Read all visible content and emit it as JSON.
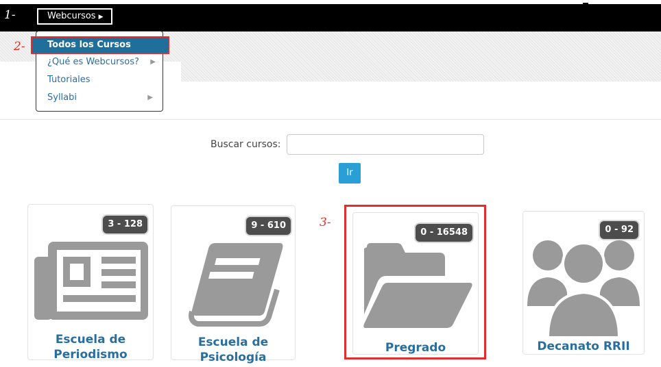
{
  "annotations": {
    "one": "1-",
    "two": "2-",
    "three": "3-"
  },
  "nav": {
    "menu_label": "Webcursos"
  },
  "dropdown": {
    "items": [
      {
        "label": "Todos los Cursos",
        "has_submenu": false,
        "active": true
      },
      {
        "label": "¿Qué es Webcursos?",
        "has_submenu": true
      },
      {
        "label": "Tutoriales",
        "has_submenu": false
      },
      {
        "label": "Syllabi",
        "has_submenu": true
      }
    ]
  },
  "search": {
    "label": "Buscar cursos:",
    "value": "",
    "placeholder": "",
    "button_label": "Ir"
  },
  "categories": [
    {
      "title_line1": "Escuela de",
      "title_line2": "Periodismo",
      "badge": "3 - 128",
      "icon": "newspaper-icon"
    },
    {
      "title_line1": "Escuela de",
      "title_line2": "Psicología",
      "badge": "9 - 610",
      "icon": "book-icon"
    },
    {
      "title_line1": "Pregrado",
      "badge": "0 - 16548",
      "icon": "folder-open-icon",
      "highlighted": true
    },
    {
      "title_line1": "Decanato RRII",
      "badge": "0 - 92",
      "icon": "users-icon"
    }
  ],
  "colors": {
    "link": "#2a6e9e",
    "accent": "#2a9fd6",
    "annotation": "#e32d2d",
    "icon": "#9a9a9a",
    "badge": "#4d4d4d"
  }
}
